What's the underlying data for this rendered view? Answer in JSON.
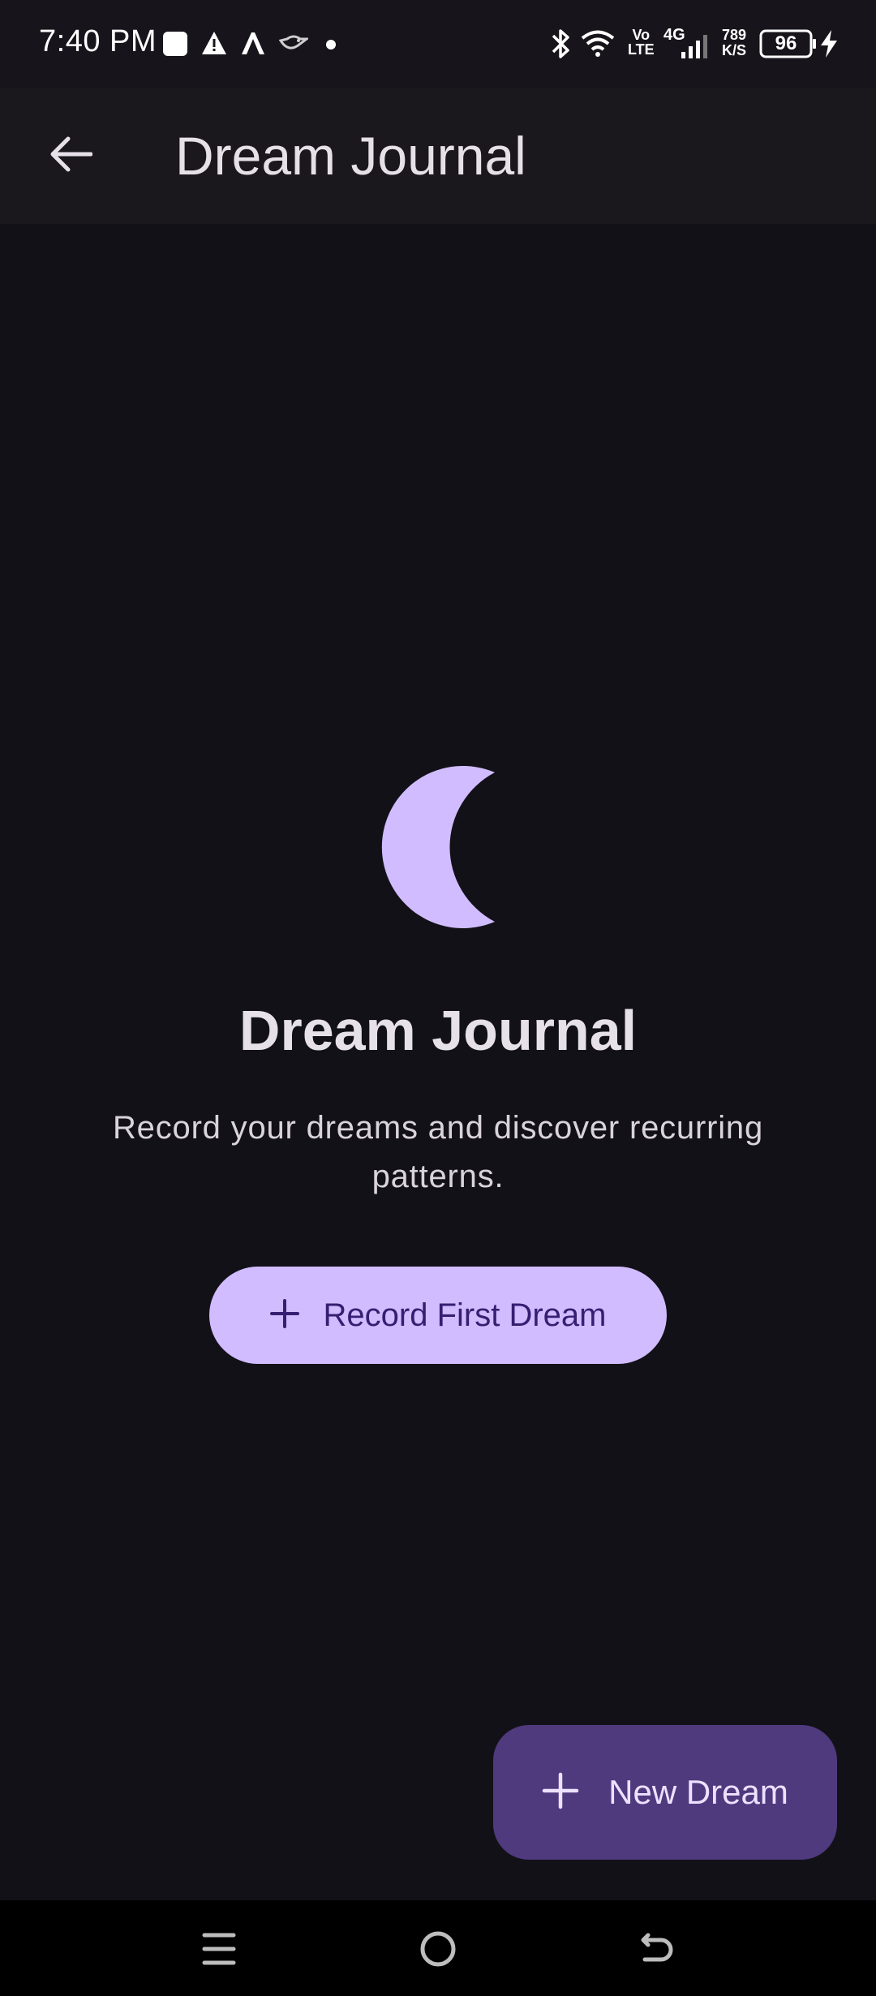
{
  "status_bar": {
    "time": "7:40 PM",
    "volte": "Vo",
    "volte_sub": "LTE",
    "network": "4G",
    "speed_value": "789",
    "speed_unit": "K/S",
    "battery": "96",
    "icons": [
      "square-notification-icon",
      "warning-icon",
      "app-logo-icon",
      "bird-icon",
      "dot-icon",
      "bluetooth-icon",
      "wifi-icon",
      "signal-icon",
      "battery-icon",
      "charging-icon"
    ]
  },
  "app_bar": {
    "title": "Dream Journal",
    "back_icon": "arrow-left-icon"
  },
  "empty_state": {
    "icon": "moon-icon",
    "title": "Dream Journal",
    "description": "Record your dreams and discover recurring patterns.",
    "button_label": "Record First Dream"
  },
  "fab": {
    "label": "New Dream",
    "icon": "plus-icon"
  },
  "nav_bar": {
    "icons": [
      "menu-icon",
      "home-icon",
      "back-icon"
    ]
  },
  "colors": {
    "background": "#131118",
    "accent": "#d0bcff",
    "on_accent": "#381e72",
    "fab_background": "#4f3a7e",
    "fab_text": "#ece1ff"
  }
}
